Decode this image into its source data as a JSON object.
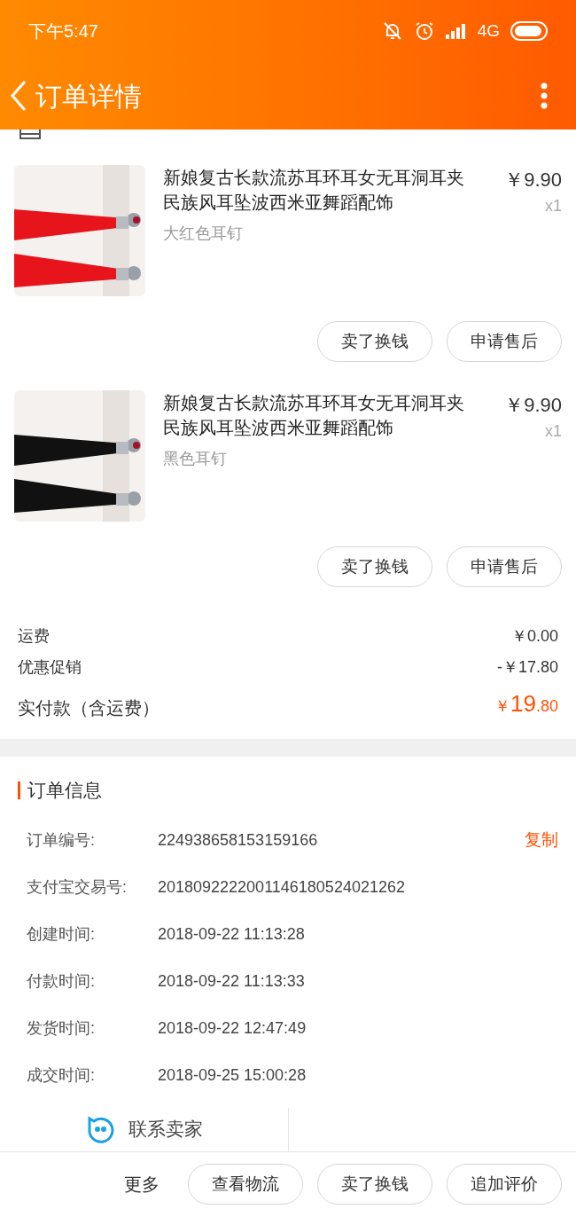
{
  "status_bar": {
    "time": "下午5:47",
    "network": "4G"
  },
  "header": {
    "title": "订单详情"
  },
  "items": [
    {
      "title": "新娘复古长款流苏耳环耳女无耳洞耳夹民族风耳坠波西米亚舞蹈配饰",
      "variant": "大红色耳钉",
      "price": "￥9.90",
      "qty": "x1",
      "buttons": [
        "卖了换钱",
        "申请售后"
      ]
    },
    {
      "title": "新娘复古长款流苏耳环耳女无耳洞耳夹民族风耳坠波西米亚舞蹈配饰",
      "variant": "黑色耳钉",
      "price": "￥9.90",
      "qty": "x1",
      "buttons": [
        "卖了换钱",
        "申请售后"
      ]
    }
  ],
  "fees": [
    {
      "label": "运费",
      "value": "￥0.00"
    },
    {
      "label": "优惠促销",
      "value": "-￥17.80"
    }
  ],
  "total": {
    "label": "实付款（含运费）",
    "currency": "￥",
    "integer": "19",
    "decimal": ".80"
  },
  "order_info": {
    "title": "订单信息",
    "copy": "复制",
    "rows": [
      {
        "label": "订单编号:",
        "value": "224938658153159166"
      },
      {
        "label": "支付宝交易号:",
        "value": "2018092222001146180524021262"
      },
      {
        "label": "创建时间:",
        "value": "2018-09-22 11:13:28"
      },
      {
        "label": "付款时间:",
        "value": "2018-09-22 11:13:33"
      },
      {
        "label": "发货时间:",
        "value": "2018-09-22 12:47:49"
      },
      {
        "label": "成交时间:",
        "value": "2018-09-25 15:00:28"
      }
    ]
  },
  "contact": "联系卖家",
  "bottom_bar": {
    "more": "更多",
    "buttons": [
      "查看物流",
      "卖了换钱",
      "追加评价"
    ]
  }
}
